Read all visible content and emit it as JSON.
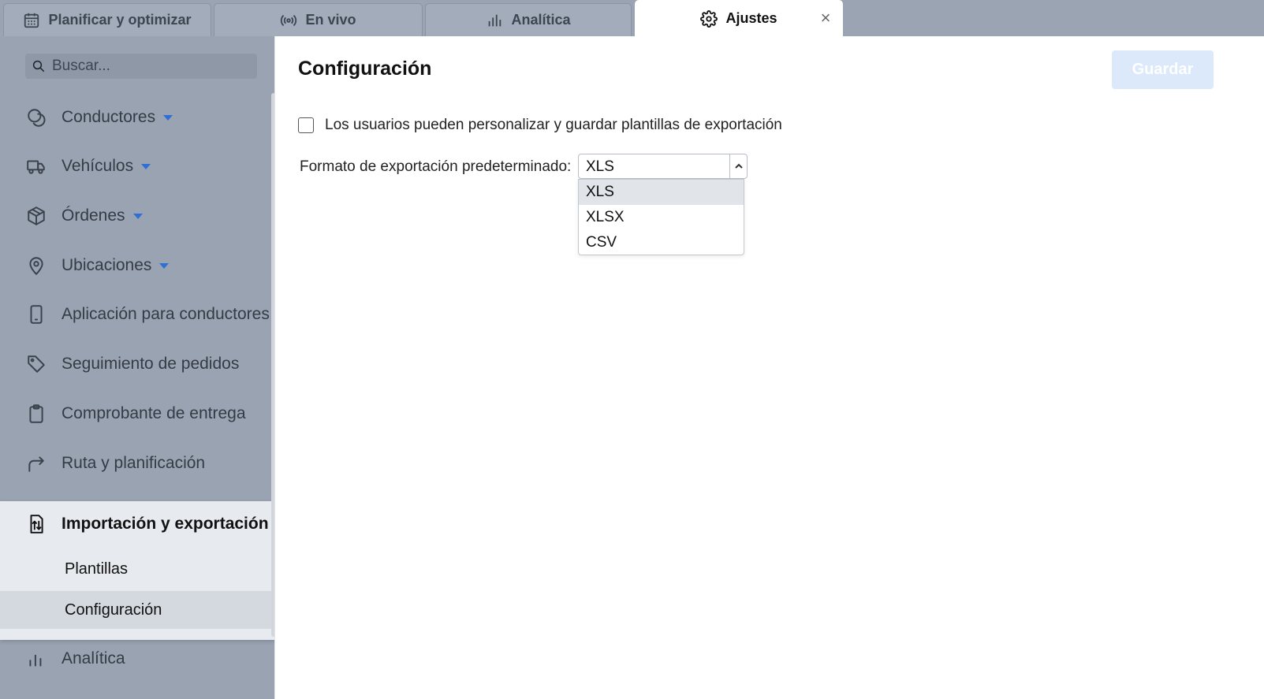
{
  "tabs": [
    {
      "label": "Planificar y optimizar",
      "icon": "calendar-icon"
    },
    {
      "label": "En vivo",
      "icon": "broadcast-icon"
    },
    {
      "label": "Analítica",
      "icon": "bar-chart-icon"
    },
    {
      "label": "Ajustes",
      "icon": "gear-icon",
      "active": true
    }
  ],
  "sidebar": {
    "search_placeholder": "Buscar...",
    "items": [
      {
        "label": "Conductores",
        "icon": "drivers-icon",
        "has_caret": true
      },
      {
        "label": "Vehículos",
        "icon": "truck-icon",
        "has_caret": true
      },
      {
        "label": "Órdenes",
        "icon": "package-icon",
        "has_caret": true
      },
      {
        "label": "Ubicaciones",
        "icon": "location-pin-icon",
        "has_caret": true
      },
      {
        "label": "Aplicación para conductores",
        "icon": "phone-icon"
      },
      {
        "label": "Seguimiento de pedidos",
        "icon": "tag-icon"
      },
      {
        "label": "Comprobante de entrega",
        "icon": "clipboard-icon"
      },
      {
        "label": "Ruta y planificación",
        "icon": "route-arrow-icon"
      },
      {
        "label": "Importación y exportación",
        "icon": "import-export-icon",
        "expanded": true
      },
      {
        "label": "Analítica",
        "icon": "bar-chart-icon"
      }
    ],
    "subitems": [
      {
        "label": "Plantillas"
      },
      {
        "label": "Configuración",
        "selected": true
      }
    ]
  },
  "main": {
    "title": "Configuración",
    "save_label": "Guardar",
    "checkbox_label": "Los usuarios pueden personalizar y guardar plantillas de exportación",
    "checkbox_checked": false,
    "format_label": "Formato de exportación predeterminado:",
    "format_value": "XLS",
    "format_options": [
      "XLS",
      "XLSX",
      "CSV"
    ],
    "highlighted_option": "XLS"
  },
  "colors": {
    "accent": "#2f6fd6",
    "save_disabled": "#dbe9fa",
    "sidebar_bg": "#9aa3b2",
    "active_panel_bg": "#e7eaee"
  }
}
